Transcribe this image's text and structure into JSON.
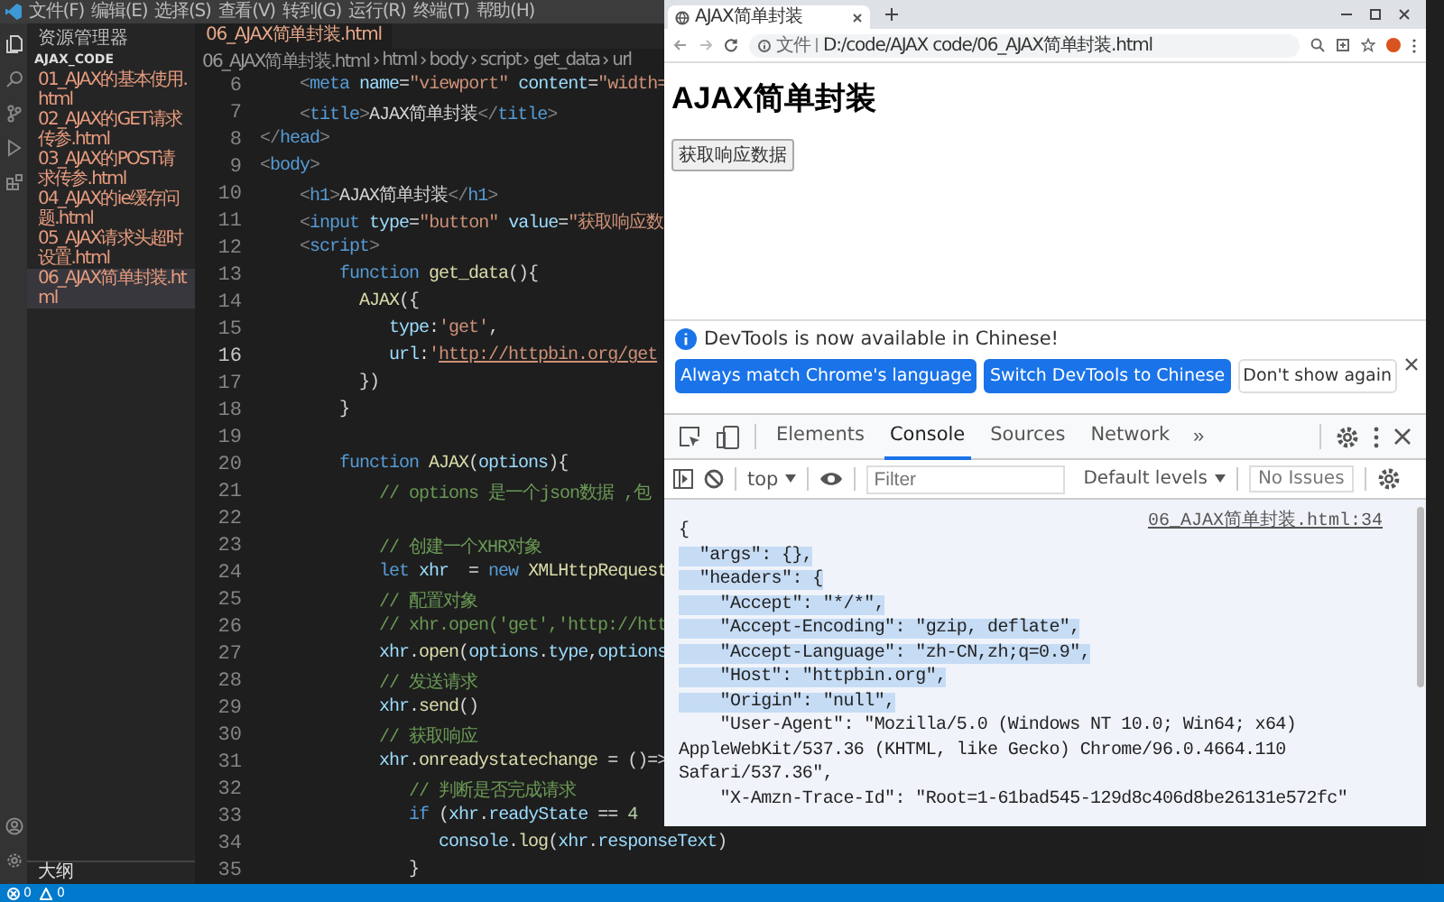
{
  "vscode": {
    "menu": [
      "文件(F)",
      "编辑(E)",
      "选择(S)",
      "查看(V)",
      "转到(G)",
      "运行(R)",
      "终端(T)",
      "帮助(H)"
    ],
    "explorer": {
      "title": "资源管理器",
      "folder": "AJAX_CODE",
      "files": [
        {
          "name": "01_AJAX的基本使用.html",
          "selected": false
        },
        {
          "name": "02_AJAX的GET请求传参.html",
          "selected": false
        },
        {
          "name": "03_AJAX的POST请求传参.html",
          "selected": false
        },
        {
          "name": "04_AJAX的ie缓存问题.html",
          "selected": false
        },
        {
          "name": "05_AJAX请求头超时设置.html",
          "selected": false
        },
        {
          "name": "06_AJAX简单封装.html",
          "selected": true
        }
      ],
      "outline": "大纲"
    },
    "editor": {
      "tab": "06_AJAX简单封装.html",
      "breadcrumbs": [
        "06_AJAX简单封装.html",
        "html",
        "body",
        "script",
        "get_data",
        "url"
      ],
      "lines": [
        {
          "number": "6",
          "current": false,
          "tokens": [
            {
              "kind": "p",
              "text": "    <"
            },
            {
              "kind": "t",
              "text": "meta"
            },
            {
              "kind": "a",
              "text": " name"
            },
            {
              "kind": "x",
              "text": "="
            },
            {
              "kind": "s",
              "text": "\"viewport\""
            },
            {
              "kind": "a",
              "text": " content"
            },
            {
              "kind": "x",
              "text": "="
            },
            {
              "kind": "s",
              "text": "\"width="
            }
          ]
        },
        {
          "number": "7",
          "current": false,
          "tokens": [
            {
              "kind": "p",
              "text": "    <"
            },
            {
              "kind": "t",
              "text": "title"
            },
            {
              "kind": "p",
              "text": ">"
            },
            {
              "kind": "x",
              "text": "AJAX简单封装"
            },
            {
              "kind": "p",
              "text": "</"
            },
            {
              "kind": "t",
              "text": "title"
            },
            {
              "kind": "p",
              "text": ">"
            }
          ]
        },
        {
          "number": "8",
          "current": false,
          "tokens": [
            {
              "kind": "p",
              "text": "</"
            },
            {
              "kind": "t",
              "text": "head"
            },
            {
              "kind": "p",
              "text": ">"
            }
          ]
        },
        {
          "number": "9",
          "current": false,
          "tokens": [
            {
              "kind": "p",
              "text": "<"
            },
            {
              "kind": "t",
              "text": "body"
            },
            {
              "kind": "p",
              "text": ">"
            }
          ]
        },
        {
          "number": "10",
          "current": false,
          "tokens": [
            {
              "kind": "p",
              "text": "    <"
            },
            {
              "kind": "t",
              "text": "h1"
            },
            {
              "kind": "p",
              "text": ">"
            },
            {
              "kind": "x",
              "text": "AJAX简单封装"
            },
            {
              "kind": "p",
              "text": "</"
            },
            {
              "kind": "t",
              "text": "h1"
            },
            {
              "kind": "p",
              "text": ">"
            }
          ]
        },
        {
          "number": "11",
          "current": false,
          "tokens": [
            {
              "kind": "p",
              "text": "    <"
            },
            {
              "kind": "t",
              "text": "input"
            },
            {
              "kind": "a",
              "text": " type"
            },
            {
              "kind": "x",
              "text": "="
            },
            {
              "kind": "s",
              "text": "\"button\""
            },
            {
              "kind": "a",
              "text": " value"
            },
            {
              "kind": "x",
              "text": "="
            },
            {
              "kind": "s",
              "text": "\"获取响应数"
            }
          ]
        },
        {
          "number": "12",
          "current": false,
          "tokens": [
            {
              "kind": "p",
              "text": "    <"
            },
            {
              "kind": "t",
              "text": "script"
            },
            {
              "kind": "p",
              "text": ">"
            }
          ]
        },
        {
          "number": "13",
          "current": false,
          "tokens": [
            {
              "kind": "k",
              "text": "        function"
            },
            {
              "kind": "f",
              "text": " get_data"
            },
            {
              "kind": "x",
              "text": "(){"
            }
          ]
        },
        {
          "number": "14",
          "current": false,
          "tokens": [
            {
              "kind": "f",
              "text": "          AJAX"
            },
            {
              "kind": "x",
              "text": "({"
            }
          ]
        },
        {
          "number": "15",
          "current": false,
          "tokens": [
            {
              "kind": "v",
              "text": "             type"
            },
            {
              "kind": "x",
              "text": ":"
            },
            {
              "kind": "s",
              "text": "'get'"
            },
            {
              "kind": "x",
              "text": ","
            }
          ]
        },
        {
          "number": "16",
          "current": true,
          "tokens": [
            {
              "kind": "v",
              "text": "             url"
            },
            {
              "kind": "x",
              "text": ":"
            },
            {
              "kind": "s",
              "text": "'"
            },
            {
              "kind": "u",
              "text": "http://httpbin.org/get"
            }
          ]
        },
        {
          "number": "17",
          "current": false,
          "tokens": [
            {
              "kind": "x",
              "text": "          })"
            }
          ]
        },
        {
          "number": "18",
          "current": false,
          "tokens": [
            {
              "kind": "x",
              "text": "        }"
            }
          ]
        },
        {
          "number": "19",
          "current": false
        },
        {
          "number": "20",
          "current": false,
          "tokens": [
            {
              "kind": "k",
              "text": "        function"
            },
            {
              "kind": "f",
              "text": " AJAX"
            },
            {
              "kind": "x",
              "text": "("
            },
            {
              "kind": "v",
              "text": "options"
            },
            {
              "kind": "x",
              "text": "){"
            }
          ]
        },
        {
          "number": "21",
          "current": false,
          "tokens": [
            {
              "kind": "c",
              "text": "            // options 是一个json数据 ,包"
            }
          ]
        },
        {
          "number": "22",
          "current": false
        },
        {
          "number": "23",
          "current": false,
          "tokens": [
            {
              "kind": "c",
              "text": "            // 创建一个XHR对象"
            }
          ]
        },
        {
          "number": "24",
          "current": false,
          "tokens": [
            {
              "kind": "k",
              "text": "            let"
            },
            {
              "kind": "v",
              "text": " xhr"
            },
            {
              "kind": "x",
              "text": "  = "
            },
            {
              "kind": "k",
              "text": "new"
            },
            {
              "kind": "f",
              "text": " XMLHttpRequest"
            }
          ]
        },
        {
          "number": "25",
          "current": false,
          "tokens": [
            {
              "kind": "c",
              "text": "            // 配置对象"
            }
          ]
        },
        {
          "number": "26",
          "current": false,
          "tokens": [
            {
              "kind": "c",
              "text": "            // xhr.open('get','http://htt"
            }
          ]
        },
        {
          "number": "27",
          "current": false,
          "tokens": [
            {
              "kind": "v",
              "text": "            xhr"
            },
            {
              "kind": "x",
              "text": "."
            },
            {
              "kind": "f",
              "text": "open"
            },
            {
              "kind": "x",
              "text": "("
            },
            {
              "kind": "v",
              "text": "options"
            },
            {
              "kind": "x",
              "text": "."
            },
            {
              "kind": "v",
              "text": "type"
            },
            {
              "kind": "x",
              "text": ","
            },
            {
              "kind": "v",
              "text": "options"
            }
          ]
        },
        {
          "number": "28",
          "current": false,
          "tokens": [
            {
              "kind": "c",
              "text": "            // 发送请求"
            }
          ]
        },
        {
          "number": "29",
          "current": false,
          "tokens": [
            {
              "kind": "v",
              "text": "            xhr"
            },
            {
              "kind": "x",
              "text": "."
            },
            {
              "kind": "f",
              "text": "send"
            },
            {
              "kind": "x",
              "text": "()"
            }
          ]
        },
        {
          "number": "30",
          "current": false,
          "tokens": [
            {
              "kind": "c",
              "text": "            // 获取响应"
            }
          ]
        },
        {
          "number": "31",
          "current": false,
          "tokens": [
            {
              "kind": "v",
              "text": "            xhr"
            },
            {
              "kind": "x",
              "text": "."
            },
            {
              "kind": "f",
              "text": "onreadystatechange"
            },
            {
              "kind": "x",
              "text": " = ()=>"
            }
          ]
        },
        {
          "number": "32",
          "current": false,
          "tokens": [
            {
              "kind": "c",
              "text": "               // 判断是否完成请求"
            }
          ]
        },
        {
          "number": "33",
          "current": false,
          "tokens": [
            {
              "kind": "k",
              "text": "               if"
            },
            {
              "kind": "x",
              "text": " ("
            },
            {
              "kind": "v",
              "text": "xhr"
            },
            {
              "kind": "x",
              "text": "."
            },
            {
              "kind": "v",
              "text": "readyState"
            },
            {
              "kind": "x",
              "text": " == "
            },
            {
              "kind": "n",
              "text": "4"
            }
          ]
        },
        {
          "number": "34",
          "current": false,
          "tokens": [
            {
              "kind": "v",
              "text": "                  console"
            },
            {
              "kind": "x",
              "text": "."
            },
            {
              "kind": "f",
              "text": "log"
            },
            {
              "kind": "x",
              "text": "("
            },
            {
              "kind": "v",
              "text": "xhr"
            },
            {
              "kind": "x",
              "text": "."
            },
            {
              "kind": "v",
              "text": "responseText"
            },
            {
              "kind": "x",
              "text": ")"
            }
          ]
        },
        {
          "number": "35",
          "current": false,
          "tokens": [
            {
              "kind": "x",
              "text": "               }"
            }
          ]
        }
      ]
    },
    "status": {
      "errors": "0",
      "warnings": "0"
    }
  },
  "browser": {
    "tab": "AJAX简单封装",
    "security": "文件",
    "url": "D:/code/AJAX code/06_AJAX简单封装.html",
    "page": {
      "heading": "AJAX简单封装",
      "button": "获取响应数据"
    },
    "devtools": {
      "banner": {
        "text": "DevTools is now available in Chinese!",
        "buttons": [
          {
            "label": "Always match Chrome's language",
            "kind": "primary"
          },
          {
            "label": "Switch DevTools to Chinese",
            "kind": "primary"
          },
          {
            "label": "Don't show again",
            "kind": "plain"
          }
        ]
      },
      "tabs": [
        {
          "label": "Elements",
          "selected": false
        },
        {
          "label": "Console",
          "selected": true
        },
        {
          "label": "Sources",
          "selected": false
        },
        {
          "label": "Network",
          "selected": false
        }
      ],
      "more": "»",
      "context": "top",
      "filter_placeholder": "Filter",
      "levels": "Default levels",
      "issues": "No Issues",
      "source_link": "06_AJAX简单封装.html:34",
      "output": [
        {
          "text": "{",
          "highlighted": false
        },
        {
          "text": "  \"args\": {},",
          "highlighted": true
        },
        {
          "text": "  \"headers\": {",
          "highlighted": true
        },
        {
          "text": "    \"Accept\": \"*/*\",",
          "highlighted": true
        },
        {
          "text": "    \"Accept-Encoding\": \"gzip, deflate\",",
          "highlighted": true
        },
        {
          "text": "    \"Accept-Language\": \"zh-CN,zh;q=0.9\",",
          "highlighted": true
        },
        {
          "text": "    \"Host\": \"httpbin.org\",",
          "highlighted": true
        },
        {
          "text": "    \"Origin\": \"null\",",
          "highlighted": true
        },
        {
          "text": "    \"User-Agent\": \"Mozilla/5.0 (Windows NT 10.0; Win64; x64)",
          "highlighted": false
        },
        {
          "text": "AppleWebKit/537.36 (KHTML, like Gecko) Chrome/96.0.4664.110",
          "highlighted": false
        },
        {
          "text": "Safari/537.36\",",
          "highlighted": false
        },
        {
          "text": "    \"X-Amzn-Trace-Id\": \"Root=1-61bad545-129d8c406d8be26131e572fc\"",
          "highlighted": false
        }
      ]
    }
  }
}
